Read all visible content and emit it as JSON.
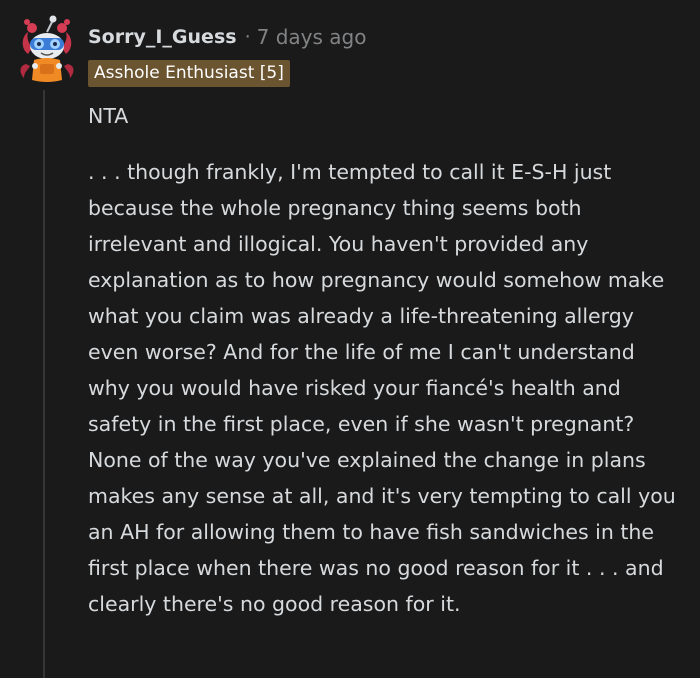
{
  "comment": {
    "username": "Sorry_I_Guess",
    "separator": "·",
    "timestamp": "7 days ago",
    "flair": "Asshole Enthusiast [5]",
    "verdict": "NTA",
    "body": ". . . though frankly, I'm tempted to call it E-S-H just because the whole pregnancy thing seems both irrelevant and illogical. You haven't provided any explanation as to how pregnancy would somehow make what you claim was already a life-threatening allergy even worse? And for the life of me I can't understand why you would have risked your fiancé's health and safety in the first place, even if she wasn't pregnant? None of the way you've explained the change in plans makes any sense at all, and it's very tempting to call you an AH for allowing them to have fish sandwiches in the first place when there was no good reason for it . . . and clearly there's no good reason for it."
  },
  "colors": {
    "background": "#1a1a1b",
    "text": "#d7dadc",
    "meta": "#818384",
    "flair_bg": "#6b5430",
    "thread_line": "#343536"
  },
  "icons": {
    "avatar": "snoo-avatar-icon"
  }
}
